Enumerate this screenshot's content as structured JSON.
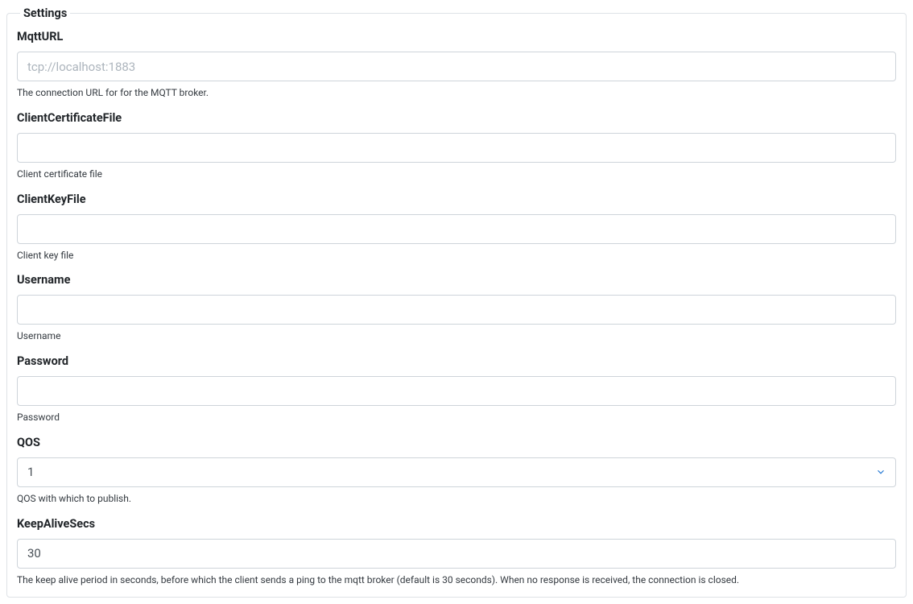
{
  "legend": "Settings",
  "fields": {
    "mqtturl": {
      "label": "MqttURL",
      "placeholder": "tcp://localhost:1883",
      "value": "",
      "help": "The connection URL for for the MQTT broker."
    },
    "clientcert": {
      "label": "ClientCertificateFile",
      "placeholder": "",
      "value": "",
      "help": "Client certificate file"
    },
    "clientkey": {
      "label": "ClientKeyFile",
      "placeholder": "",
      "value": "",
      "help": "Client key file"
    },
    "username": {
      "label": "Username",
      "placeholder": "",
      "value": "",
      "help": "Username"
    },
    "password": {
      "label": "Password",
      "placeholder": "",
      "value": "",
      "help": "Password"
    },
    "qos": {
      "label": "QOS",
      "selected": "1",
      "help": "QOS with which to publish."
    },
    "keepalive": {
      "label": "KeepAliveSecs",
      "value": "30",
      "help": "The keep alive period in seconds, before which the client sends a ping to the mqtt broker (default is 30 seconds). When no response is received, the connection is closed."
    }
  }
}
